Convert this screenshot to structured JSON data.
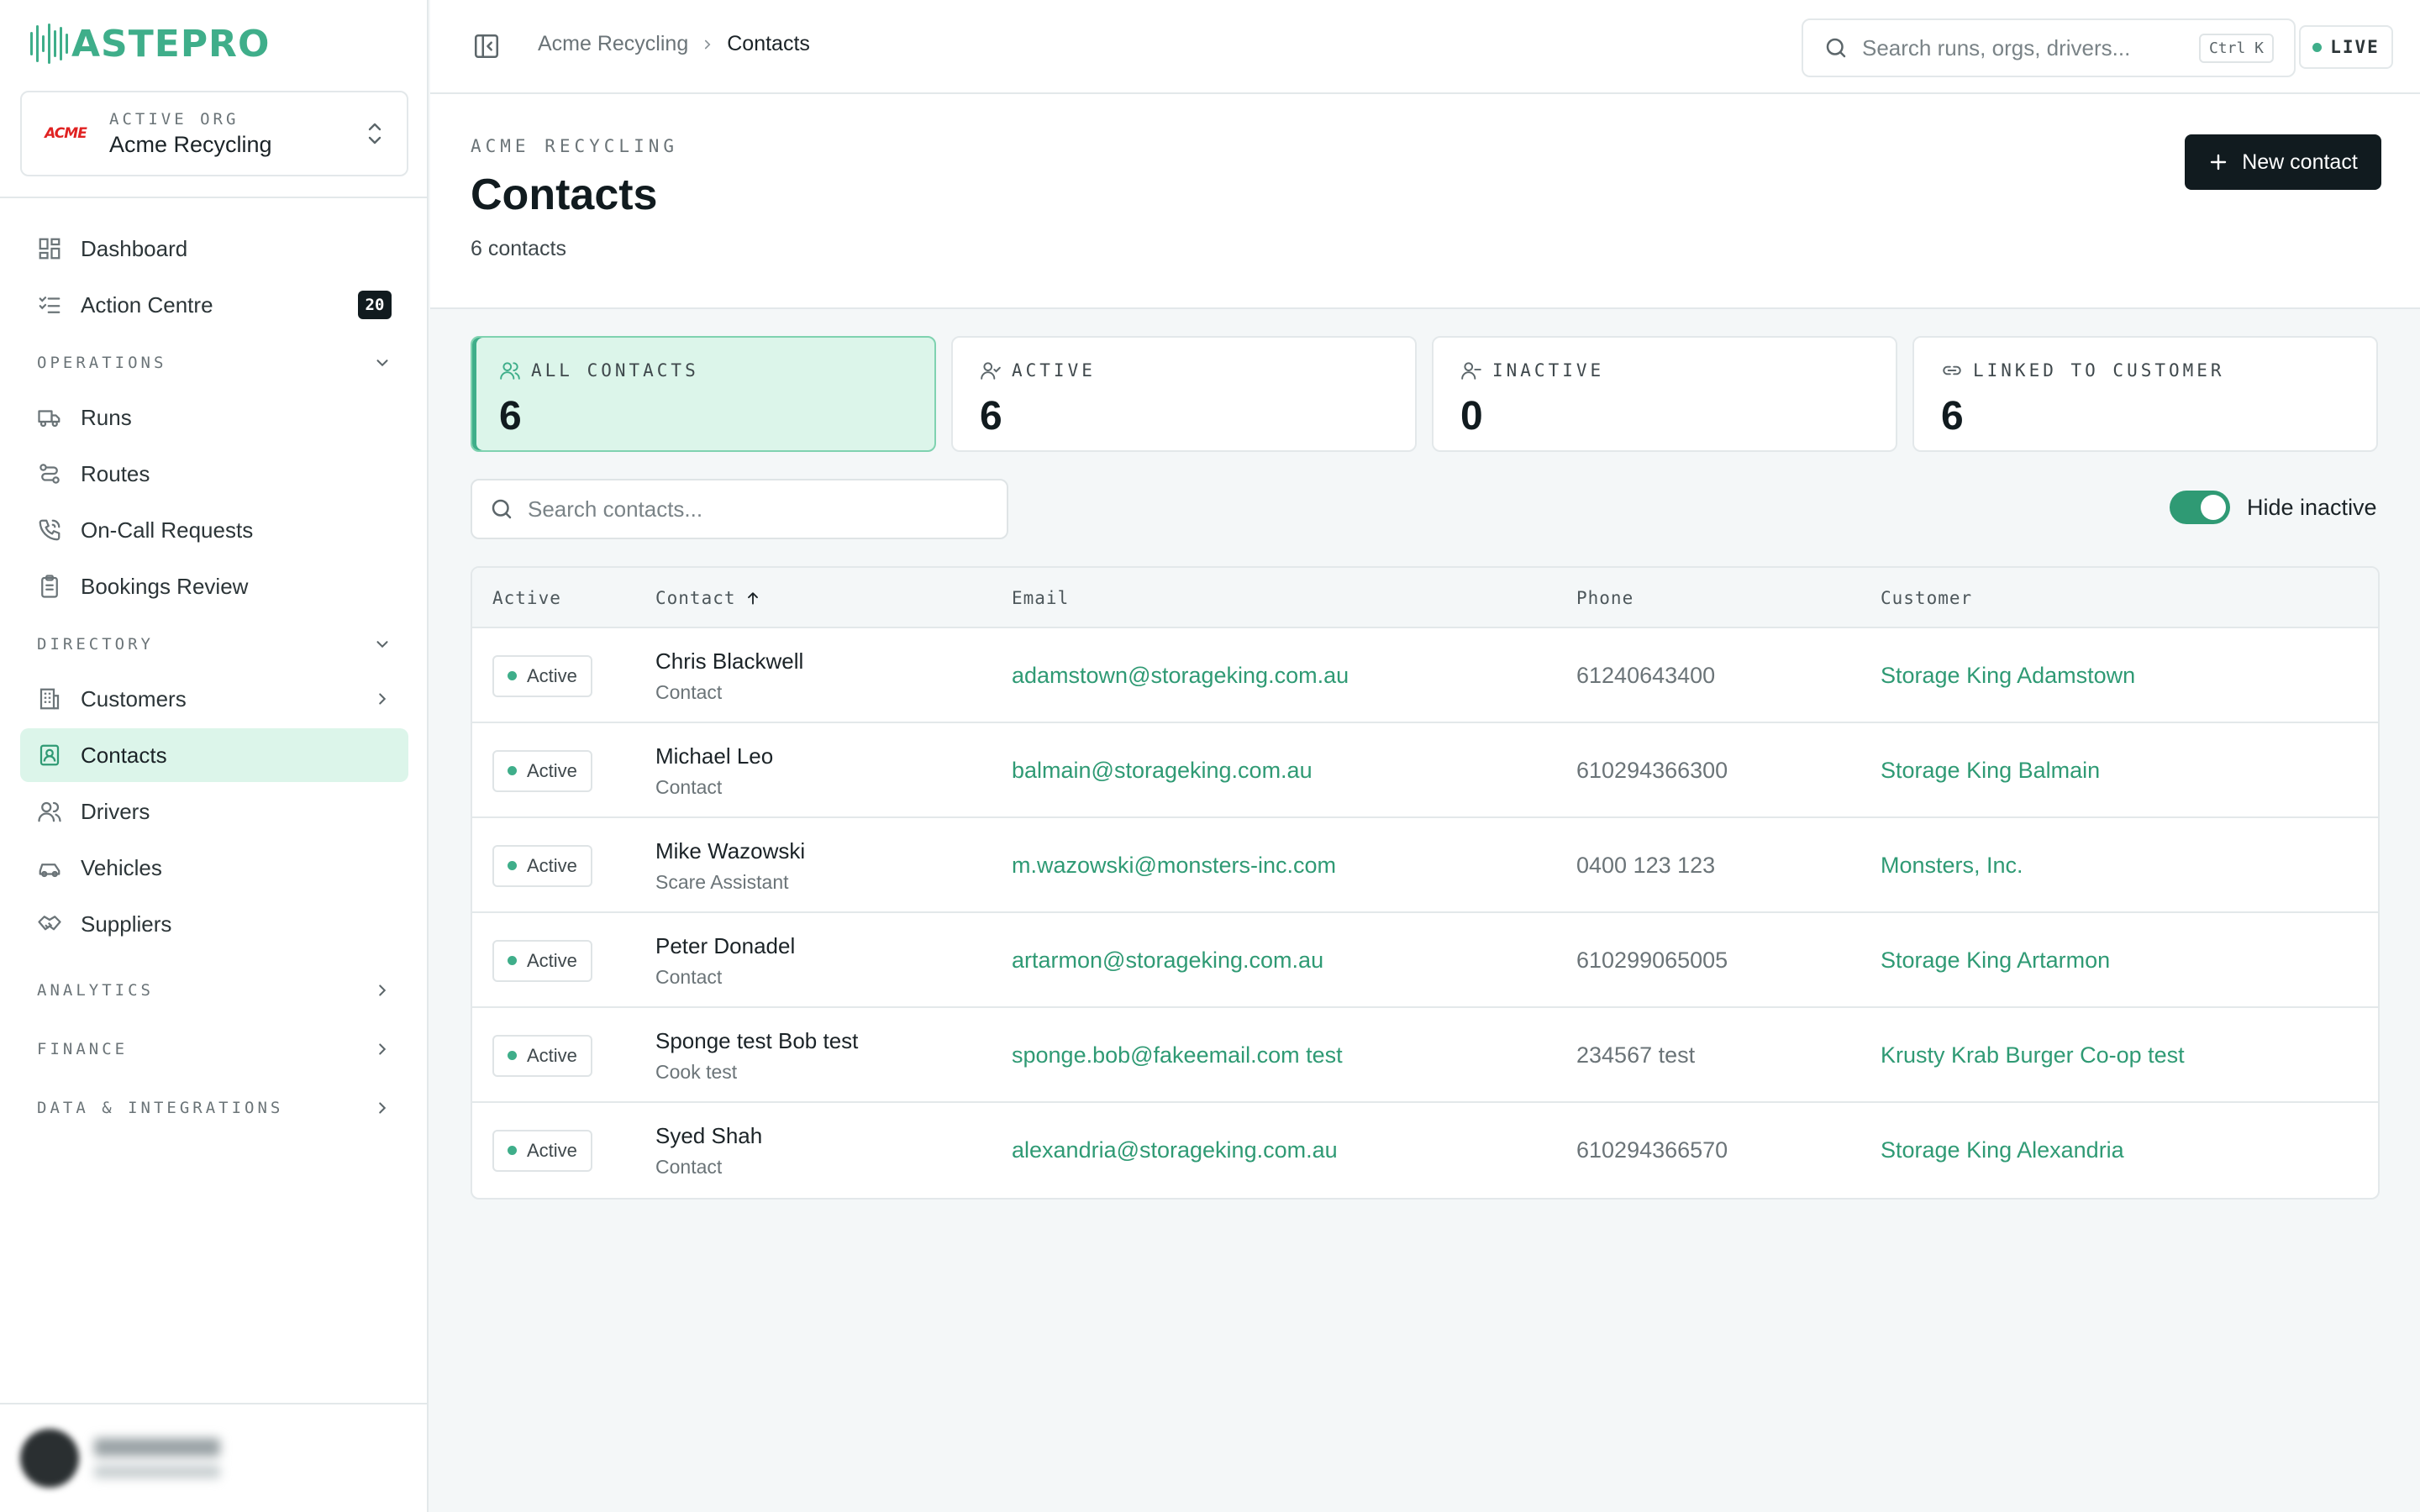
{
  "app": {
    "logo_text": "ASTEPRO",
    "org_label": "ACTIVE ORG",
    "org_name": "Acme Recycling",
    "org_logo_text": "ACME"
  },
  "sidebar": {
    "top_items": [
      {
        "label": "Dashboard",
        "icon": "dashboard-icon"
      },
      {
        "label": "Action Centre",
        "icon": "checklist-icon",
        "badge": "20"
      }
    ],
    "sections": {
      "operations": {
        "label": "OPERATIONS",
        "items": [
          {
            "label": "Runs",
            "icon": "truck-icon"
          },
          {
            "label": "Routes",
            "icon": "route-icon"
          },
          {
            "label": "On-Call Requests",
            "icon": "phone-icon"
          },
          {
            "label": "Bookings Review",
            "icon": "clipboard-icon"
          }
        ]
      },
      "directory": {
        "label": "DIRECTORY",
        "items": [
          {
            "label": "Customers",
            "icon": "building-icon"
          },
          {
            "label": "Contacts",
            "icon": "contact-card-icon"
          },
          {
            "label": "Drivers",
            "icon": "users-icon"
          },
          {
            "label": "Vehicles",
            "icon": "car-icon"
          },
          {
            "label": "Suppliers",
            "icon": "handshake-icon"
          }
        ]
      },
      "analytics": {
        "label": "ANALYTICS"
      },
      "finance": {
        "label": "FINANCE"
      },
      "data": {
        "label": "DATA & INTEGRATIONS"
      }
    }
  },
  "topbar": {
    "breadcrumb": [
      "Acme Recycling",
      "Contacts"
    ],
    "search_placeholder": "Search runs, orgs, drivers...",
    "search_shortcut": "Ctrl K",
    "live_label": "LIVE"
  },
  "page": {
    "eyebrow": "ACME RECYCLING",
    "title": "Contacts",
    "subtitle": "6 contacts",
    "new_button": "New contact"
  },
  "stats": [
    {
      "label": "ALL CONTACTS",
      "value": "6",
      "icon": "users-icon"
    },
    {
      "label": "ACTIVE",
      "value": "6",
      "icon": "user-check-icon"
    },
    {
      "label": "INACTIVE",
      "value": "0",
      "icon": "user-minus-icon"
    },
    {
      "label": "LINKED TO CUSTOMER",
      "value": "6",
      "icon": "link-icon"
    }
  ],
  "filters": {
    "search_placeholder": "Search contacts...",
    "hide_inactive_label": "Hide inactive",
    "hide_inactive_on": true
  },
  "table": {
    "columns": [
      "Active",
      "Contact",
      "Email",
      "Phone",
      "Customer"
    ],
    "rows": [
      {
        "status": "Active",
        "name": "Chris Blackwell",
        "role": "Contact",
        "email": "adamstown@storageking.com.au",
        "phone": "61240643400",
        "customer": "Storage King Adamstown"
      },
      {
        "status": "Active",
        "name": "Michael Leo",
        "role": "Contact",
        "email": "balmain@storageking.com.au",
        "phone": "610294366300",
        "customer": "Storage King Balmain"
      },
      {
        "status": "Active",
        "name": "Mike Wazowski",
        "role": "Scare Assistant",
        "email": "m.wazowski@monsters-inc.com",
        "phone": "0400 123 123",
        "customer": "Monsters, Inc."
      },
      {
        "status": "Active",
        "name": "Peter Donadel",
        "role": "Contact",
        "email": "artarmon@storageking.com.au",
        "phone": "610299065005",
        "customer": "Storage King Artarmon"
      },
      {
        "status": "Active",
        "name": "Sponge test Bob test",
        "role": "Cook test",
        "email": "sponge.bob@fakeemail.com test",
        "phone": "234567 test",
        "customer": "Krusty Krab Burger Co-op test"
      },
      {
        "status": "Active",
        "name": "Syed Shah",
        "role": "Contact",
        "email": "alexandria@storageking.com.au",
        "phone": "610294366570",
        "customer": "Storage King Alexandria"
      }
    ]
  },
  "colors": {
    "accent": "#3fae8a",
    "link": "#2f9a74",
    "active_nav_bg": "#dcf5ea",
    "dark_button": "#111b1f"
  }
}
